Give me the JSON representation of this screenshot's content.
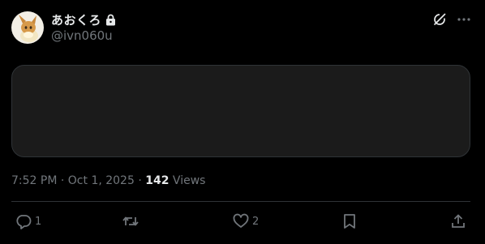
{
  "user": {
    "display_name": "あおくろ",
    "handle": "@ivn060u",
    "avatar_icon": "eevee-avatar"
  },
  "top_actions": {
    "grok_icon": "grok-icon",
    "more_icon": "more-icon"
  },
  "meta": {
    "time": "7:52 PM",
    "separator": " · ",
    "date": "Oct 1, 2025",
    "views_count": "142",
    "views_label": " Views"
  },
  "actions": {
    "reply_count": "1",
    "repost_count": "",
    "like_count": "2"
  },
  "colors": {
    "background": "#000000",
    "text_primary": "#e7e9ea",
    "text_secondary": "#71767b",
    "media_placeholder": "#1b1b1b",
    "divider": "#2f3336"
  }
}
